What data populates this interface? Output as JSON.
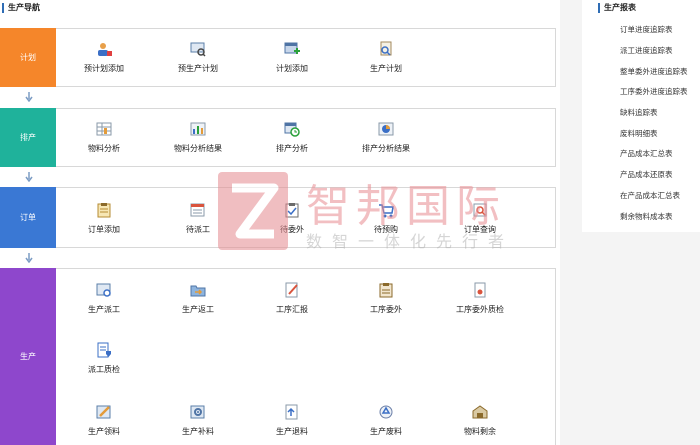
{
  "nav": {
    "title": "生产导航",
    "groups": [
      {
        "label": "计划",
        "color": "#f5862a",
        "items": [
          {
            "label": "预计划添加",
            "icon": "user-add-icon"
          },
          {
            "label": "预生产计划",
            "icon": "monitor-search-icon"
          },
          {
            "label": "计划添加",
            "icon": "window-add-icon"
          },
          {
            "label": "生产计划",
            "icon": "document-search-icon"
          }
        ]
      },
      {
        "label": "排产",
        "color": "#1fb29b",
        "items": [
          {
            "label": "物料分析",
            "icon": "table-icon"
          },
          {
            "label": "物料分析结果",
            "icon": "bar-chart-icon"
          },
          {
            "label": "排产分析",
            "icon": "calendar-clock-icon"
          },
          {
            "label": "排产分析结果",
            "icon": "pie-chart-icon"
          }
        ]
      },
      {
        "label": "订单",
        "color": "#3a78d4",
        "items": [
          {
            "label": "订单添加",
            "icon": "clipboard-icon"
          },
          {
            "label": "待派工",
            "icon": "list-window-icon"
          },
          {
            "label": "待委外",
            "icon": "clipboard-check-icon"
          },
          {
            "label": "待预购",
            "icon": "cart-icon"
          },
          {
            "label": "订单查询",
            "icon": "search-document-icon"
          }
        ]
      },
      {
        "label": "生产",
        "color": "#8e47cc",
        "items": [
          {
            "label": "生产派工",
            "icon": "search-window-icon"
          },
          {
            "label": "生产返工",
            "icon": "folder-arrow-icon"
          },
          {
            "label": "工序汇报",
            "icon": "edit-document-icon"
          },
          {
            "label": "工序委外",
            "icon": "clipboard-list-icon"
          },
          {
            "label": "工序委外质检",
            "icon": "document-seal-icon"
          },
          {
            "label": "派工质检",
            "icon": "document-shield-icon"
          },
          {
            "label": "生产领料",
            "icon": "pencil-icon"
          },
          {
            "label": "生产补料",
            "icon": "gear-window-icon"
          },
          {
            "label": "生产退料",
            "icon": "upload-document-icon"
          },
          {
            "label": "生产废料",
            "icon": "recycle-icon"
          },
          {
            "label": "物料剩余",
            "icon": "warehouse-icon"
          }
        ]
      }
    ]
  },
  "reports": {
    "title": "生产报表",
    "items": [
      "订单进度追踪表",
      "派工进度追踪表",
      "整单委外进度追踪表",
      "工序委外进度追踪表",
      "缺料追踪表",
      "废料明细表",
      "产品成本汇总表",
      "产品成本还原表",
      "在产品成本汇总表",
      "剩余物料成本表"
    ]
  },
  "watermark": {
    "name": "智邦国际",
    "slogan": "数智一体化先行者"
  },
  "colors": {
    "accent": "#2f6db5",
    "arrow": "#7b9cc4"
  }
}
